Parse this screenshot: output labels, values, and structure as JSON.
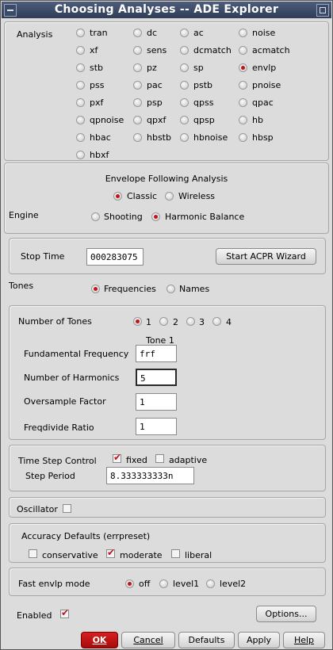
{
  "window": {
    "title": "Choosing Analyses -- ADE Explorer"
  },
  "analysis": {
    "label": "Analysis",
    "options": [
      "tran",
      "dc",
      "ac",
      "noise",
      "xf",
      "sens",
      "dcmatch",
      "acmatch",
      "stb",
      "pz",
      "sp",
      "envlp",
      "pss",
      "pac",
      "pstb",
      "pnoise",
      "pxf",
      "psp",
      "qpss",
      "qpac",
      "qpnoise",
      "qpxf",
      "qpsp",
      "hb",
      "hbac",
      "hbstb",
      "hbnoise",
      "hbsp",
      "hbxf"
    ],
    "selected": "envlp"
  },
  "envelope": {
    "heading": "Envelope Following Analysis",
    "mode_options": [
      "Classic",
      "Wireless"
    ],
    "mode_selected": "Classic",
    "engine_label": "Engine",
    "engine_options": [
      "Shooting",
      "Harmonic Balance"
    ],
    "engine_selected": "Harmonic Balance"
  },
  "stop_time": {
    "label": "Stop Time",
    "value": "000283075",
    "wizard_label": "Start ACPR Wizard"
  },
  "tones": {
    "label": "Tones",
    "options": [
      "Frequencies",
      "Names"
    ],
    "selected": "Frequencies",
    "num_label": "Number of Tones",
    "num_options": [
      "1",
      "2",
      "3",
      "4"
    ],
    "num_selected": "1",
    "column_header": "Tone 1",
    "fund_label": "Fundamental Frequency",
    "fund_value": "frf",
    "harm_label": "Number of Harmonics",
    "harm_value": "5",
    "over_label": "Oversample Factor",
    "over_value": "1",
    "freq_label": "Freqdivide Ratio",
    "freq_value": "1"
  },
  "time_step": {
    "label": "Time Step Control",
    "fixed_label": "fixed",
    "fixed_checked": true,
    "adaptive_label": "adaptive",
    "adaptive_checked": false,
    "period_label": "Step Period",
    "period_value": "8.333333333n"
  },
  "oscillator": {
    "label": "Oscillator",
    "checked": false
  },
  "accuracy": {
    "label": "Accuracy Defaults (errpreset)",
    "options": [
      {
        "label": "conservative",
        "checked": false
      },
      {
        "label": "moderate",
        "checked": true
      },
      {
        "label": "liberal",
        "checked": false
      }
    ]
  },
  "fast": {
    "label": "Fast envlp mode",
    "options": [
      "off",
      "level1",
      "level2"
    ],
    "selected": "off"
  },
  "enabled": {
    "label": "Enabled",
    "checked": true,
    "options_button": "Options..."
  },
  "buttons": {
    "ok": "OK",
    "cancel": "Cancel",
    "defaults": "Defaults",
    "apply": "Apply",
    "help": "Help"
  },
  "colors": {
    "accent": "#c0141a",
    "title_bar": "#3b4a66"
  }
}
